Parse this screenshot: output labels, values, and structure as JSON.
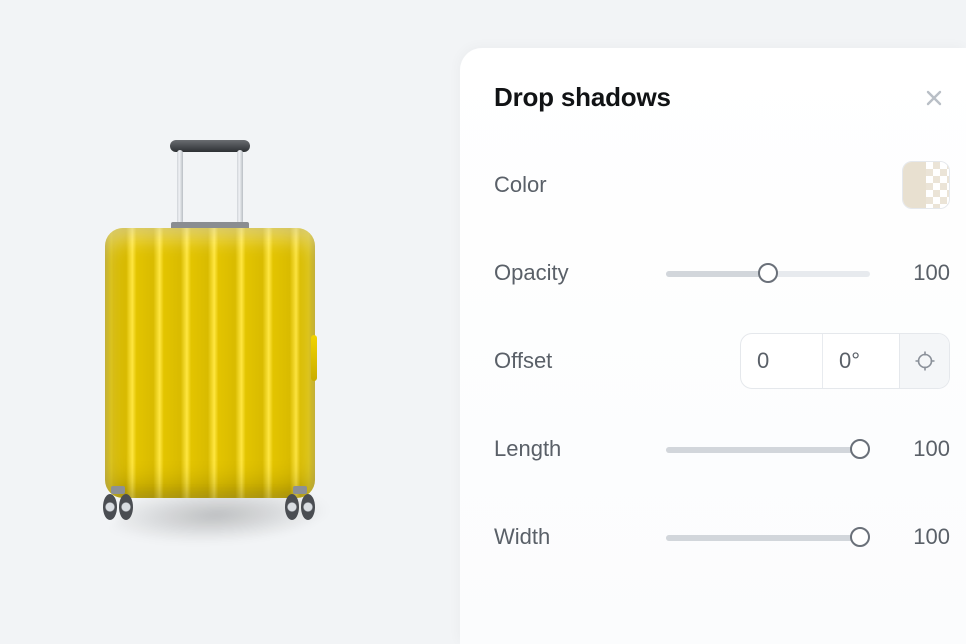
{
  "panel": {
    "title": "Drop shadows",
    "close_icon": "close-icon",
    "color": {
      "label": "Color",
      "value": "#e8e0d0"
    },
    "opacity": {
      "label": "Opacity",
      "value": 100,
      "slider_percent": 50
    },
    "offset": {
      "label": "Offset",
      "distance": "0",
      "angle": "0°",
      "target_icon": "crosshair-icon"
    },
    "length": {
      "label": "Length",
      "value": 100,
      "slider_percent": 95
    },
    "width": {
      "label": "Width",
      "value": 100,
      "slider_percent": 95
    }
  },
  "preview": {
    "object": "yellow-suitcase"
  }
}
